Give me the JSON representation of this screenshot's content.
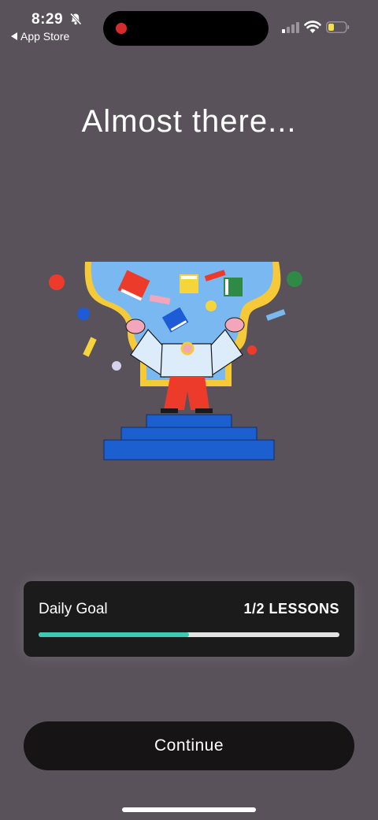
{
  "status_bar": {
    "time": "8:29",
    "back_app": "App Store",
    "icons": [
      "bell-slash-icon",
      "cellular-signal-icon",
      "wifi-icon",
      "battery-icon"
    ],
    "battery_color": "#f4e04d"
  },
  "main": {
    "title": "Almost there..."
  },
  "daily_goal": {
    "label": "Daily Goal",
    "count": "1/2 LESSONS",
    "progress_fraction": 0.5,
    "progress_color": "#3ccab4"
  },
  "actions": {
    "continue_label": "Continue"
  },
  "colors": {
    "background": "#5a525b",
    "card": "#1c1b1b",
    "button": "#161414"
  }
}
